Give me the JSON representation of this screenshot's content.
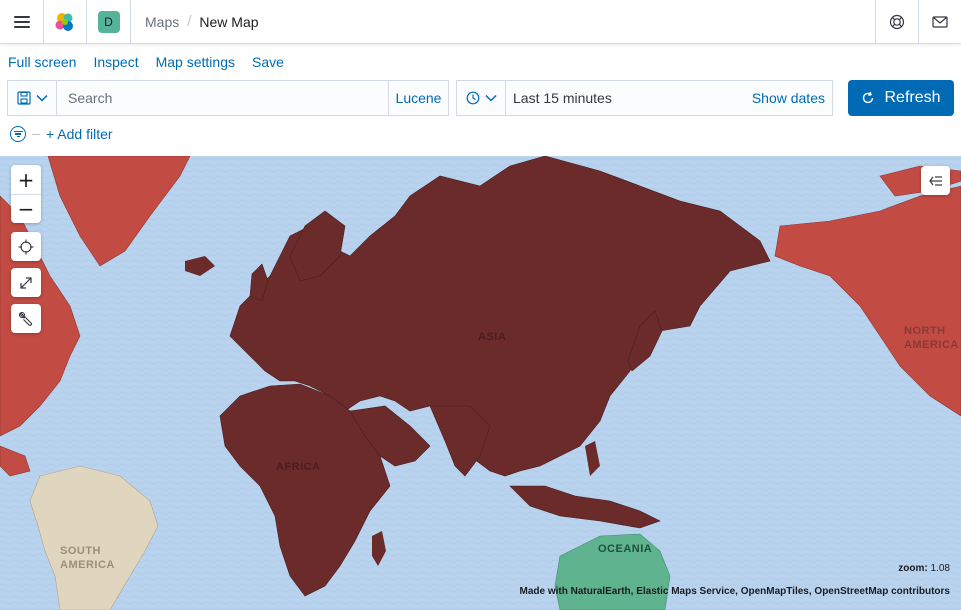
{
  "header": {
    "space_initial": "D",
    "breadcrumbs": [
      "Maps",
      "New Map"
    ],
    "icons": [
      "menu-icon",
      "elastic-logo",
      "help-icon",
      "mail-icon"
    ]
  },
  "topnav": {
    "items": [
      "Full screen",
      "Inspect",
      "Map settings",
      "Save"
    ]
  },
  "query": {
    "search_placeholder": "Search",
    "language": "Lucene"
  },
  "date": {
    "range": "Last 15 minutes",
    "show_dates": "Show dates"
  },
  "refresh": {
    "label": "Refresh"
  },
  "filter": {
    "add_label": "+ Add filter"
  },
  "map": {
    "labels": {
      "asia": "ASIA",
      "africa": "AFRICA",
      "north_america": "NORTH AMERICA",
      "south_america": "SOUTH AMERICA",
      "oceania": "OCEANIA"
    },
    "zoom_label": "zoom:",
    "zoom_value": "1.08",
    "attribution": "Made with NaturalEarth, Elastic Maps Service, OpenMapTiles, OpenStreetMap contributors",
    "colors": {
      "ocean": "#b9d3ee",
      "eurasia_africa": "#6b2b2b",
      "americas": "#c24b43",
      "south_america": "#e0d5bf",
      "oceania": "#5fb38f",
      "accent": "#006bb4"
    }
  }
}
